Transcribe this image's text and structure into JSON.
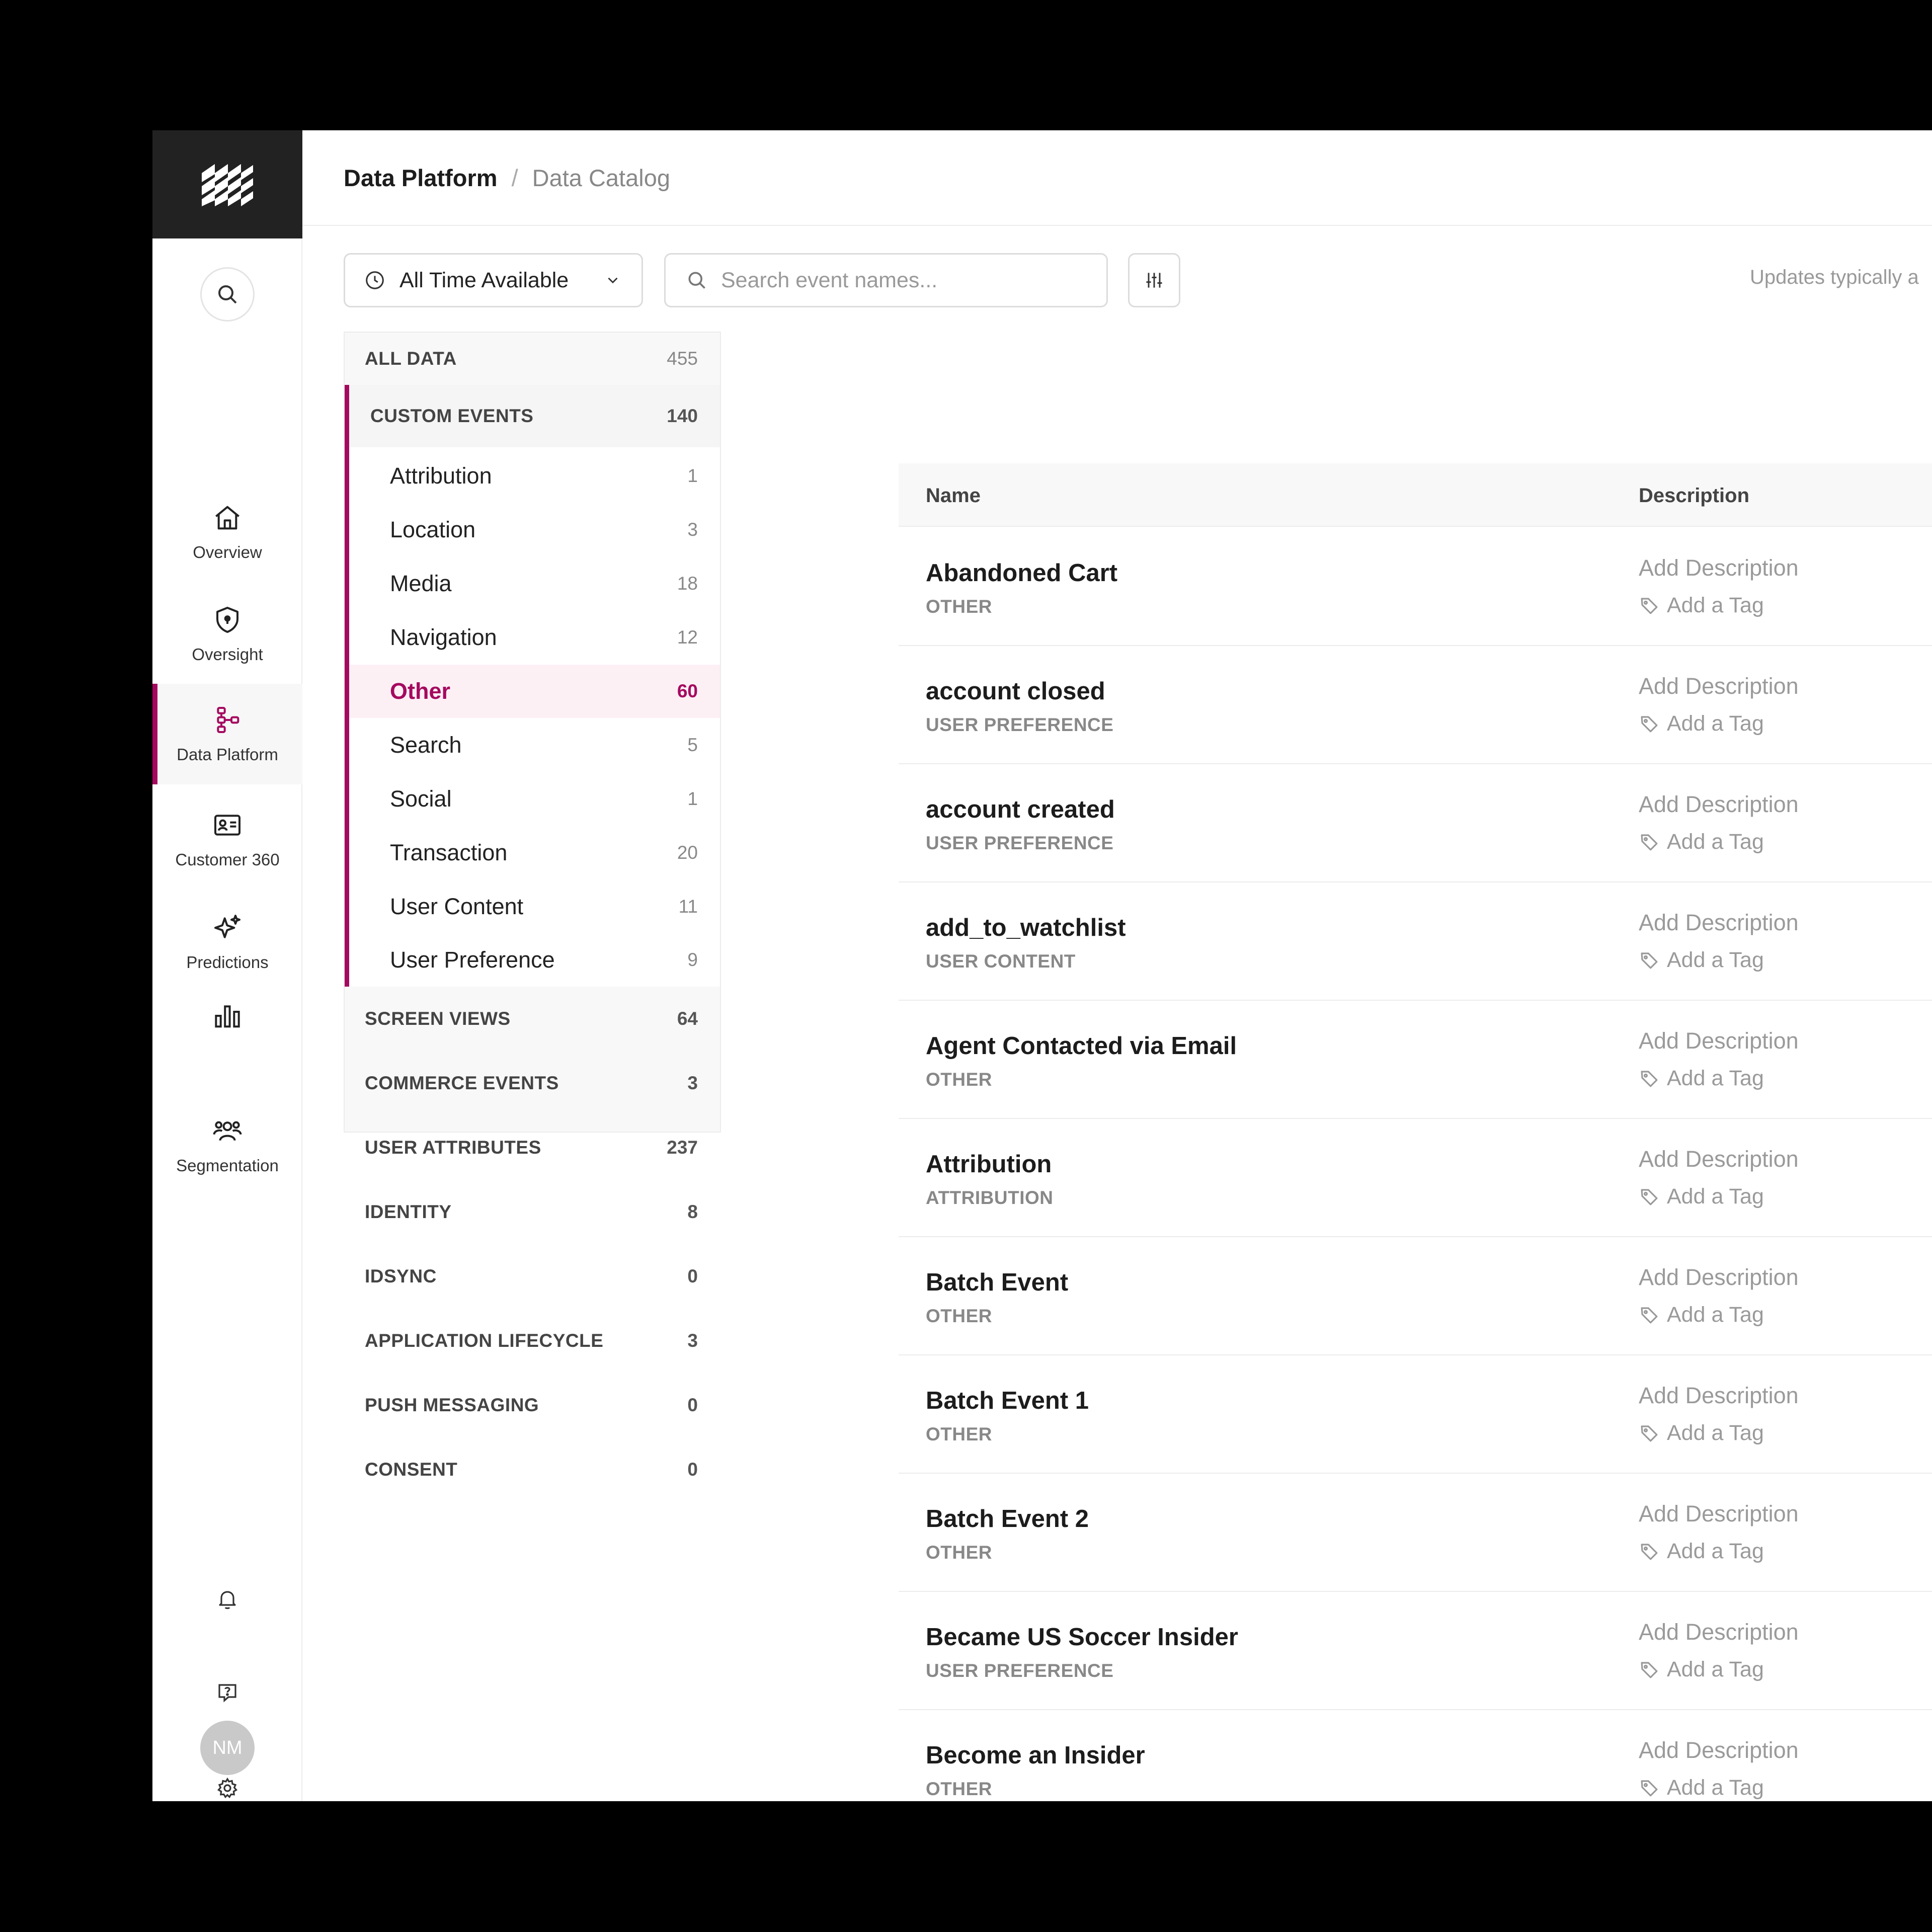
{
  "brand": {
    "accent": "#a5095f",
    "logo_bg": "#222222"
  },
  "nav": {
    "items": [
      {
        "label": "Overview",
        "icon": "home-icon"
      },
      {
        "label": "Oversight",
        "icon": "shield-icon"
      },
      {
        "label": "Data Platform",
        "icon": "data-platform-icon",
        "active": true
      },
      {
        "label": "Customer 360",
        "icon": "id-card-icon"
      },
      {
        "label": "Predictions",
        "icon": "sparkle-icon"
      },
      {
        "label": "",
        "icon": "bar-chart-icon"
      },
      {
        "label": "Segmentation",
        "icon": "users-icon"
      }
    ],
    "avatar_initials": "NM"
  },
  "header": {
    "breadcrumb_root": "Data Platform",
    "breadcrumb_sep": "/",
    "breadcrumb_current": "Data Catalog"
  },
  "toolbar": {
    "time_filter": "All Time Available",
    "search_placeholder": "Search event names...",
    "updates_note": "Updates typically a"
  },
  "categories": {
    "all_data": {
      "label": "ALL DATA",
      "count": "455"
    },
    "custom_events": {
      "label": "CUSTOM EVENTS",
      "count": "140",
      "items": [
        {
          "label": "Attribution",
          "count": "1"
        },
        {
          "label": "Location",
          "count": "3"
        },
        {
          "label": "Media",
          "count": "18"
        },
        {
          "label": "Navigation",
          "count": "12"
        },
        {
          "label": "Other",
          "count": "60",
          "selected": true
        },
        {
          "label": "Search",
          "count": "5"
        },
        {
          "label": "Social",
          "count": "1"
        },
        {
          "label": "Transaction",
          "count": "20"
        },
        {
          "label": "User Content",
          "count": "11"
        },
        {
          "label": "User Preference",
          "count": "9"
        }
      ]
    },
    "groups": [
      {
        "label": "SCREEN VIEWS",
        "count": "64"
      },
      {
        "label": "COMMERCE EVENTS",
        "count": "3"
      },
      {
        "label": "USER ATTRIBUTES",
        "count": "237"
      },
      {
        "label": "IDENTITY",
        "count": "8"
      },
      {
        "label": "IDSYNC",
        "count": "0"
      },
      {
        "label": "APPLICATION LIFECYCLE",
        "count": "3"
      },
      {
        "label": "PUSH MESSAGING",
        "count": "0"
      },
      {
        "label": "CONSENT",
        "count": "0"
      }
    ]
  },
  "table": {
    "columns": {
      "name": "Name",
      "description": "Description"
    },
    "add_description": "Add Description",
    "add_tag": "Add a Tag",
    "rows": [
      {
        "name": "Abandoned Cart",
        "category": "OTHER"
      },
      {
        "name": "account closed",
        "category": "USER PREFERENCE"
      },
      {
        "name": "account created",
        "category": "USER PREFERENCE"
      },
      {
        "name": "add_to_watchlist",
        "category": "USER CONTENT"
      },
      {
        "name": "Agent Contacted via Email",
        "category": "OTHER"
      },
      {
        "name": "Attribution",
        "category": "ATTRIBUTION"
      },
      {
        "name": "Batch Event",
        "category": "OTHER"
      },
      {
        "name": "Batch Event 1",
        "category": "OTHER"
      },
      {
        "name": "Batch Event 2",
        "category": "OTHER"
      },
      {
        "name": "Became US Soccer Insider",
        "category": "USER PREFERENCE"
      },
      {
        "name": "Become an Insider",
        "category": "OTHER"
      }
    ]
  }
}
